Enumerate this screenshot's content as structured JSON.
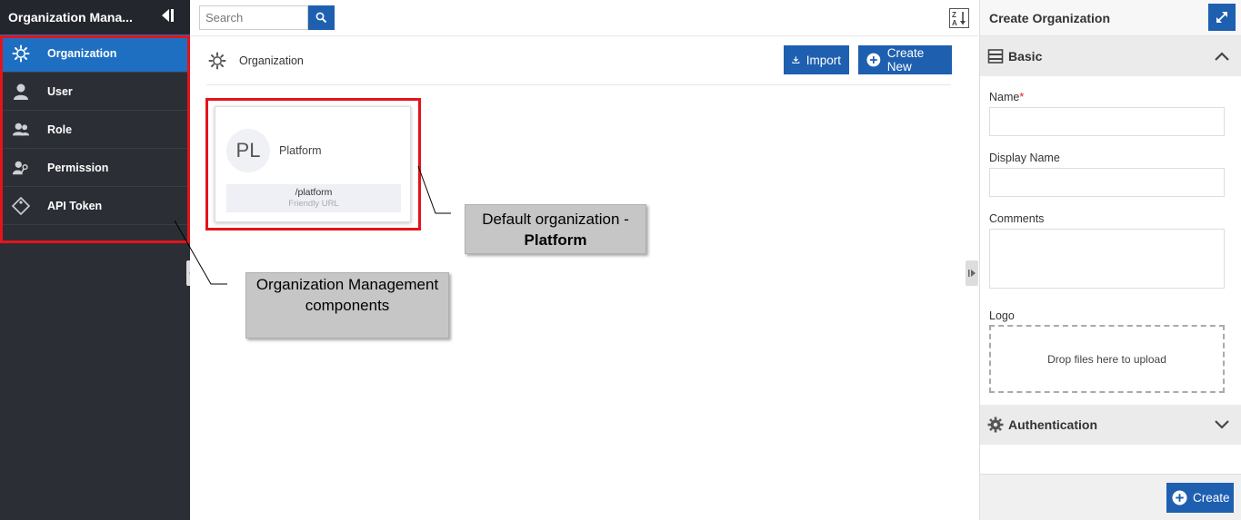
{
  "sidebar": {
    "title": "Organization Mana...",
    "items": [
      {
        "label": "Organization",
        "icon": "gear-icon",
        "active": true
      },
      {
        "label": "User",
        "icon": "user-icon",
        "active": false
      },
      {
        "label": "Role",
        "icon": "users-icon",
        "active": false
      },
      {
        "label": "Permission",
        "icon": "user-key-icon",
        "active": false
      },
      {
        "label": "API Token",
        "icon": "tag-icon",
        "active": false
      }
    ]
  },
  "search": {
    "placeholder": "Search"
  },
  "main": {
    "section_title": "Organization",
    "import_label": "Import",
    "create_new_label": "Create New",
    "card": {
      "initials": "PL",
      "name": "Platform",
      "url": "/platform",
      "url_caption": "Friendly URL"
    }
  },
  "callouts": {
    "org_components": "Organization Management components",
    "default_org_prefix": "Default organization -",
    "default_org_name": "Platform"
  },
  "panel": {
    "title": "Create Organization",
    "basic_section": "Basic",
    "name_label": "Name",
    "required_mark": "*",
    "display_name_label": "Display Name",
    "comments_label": "Comments",
    "logo_label": "Logo",
    "dropzone_text": "Drop files here to upload",
    "auth_section": "Authentication",
    "create_label": "Create"
  },
  "colors": {
    "accent": "#1e5fb0",
    "sidebar_bg": "#2c2e36",
    "active_item": "#1e6fc1",
    "highlight": "#e4141a",
    "callout_bg": "#c6c6c6"
  }
}
